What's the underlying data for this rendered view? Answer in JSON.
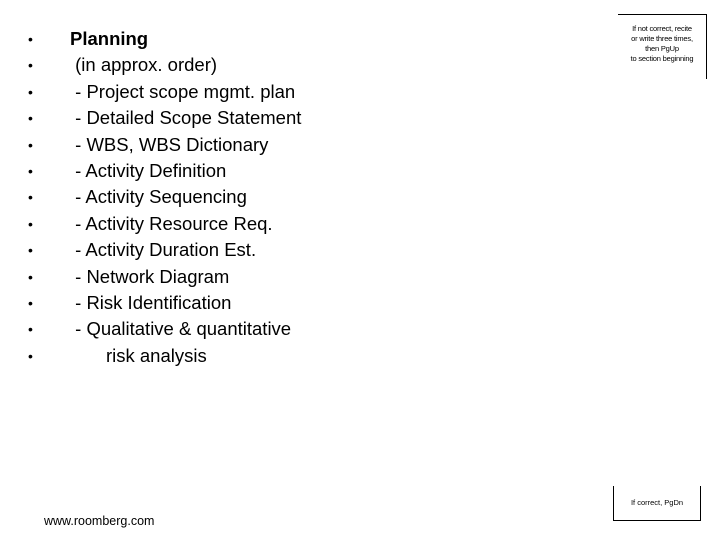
{
  "slide": {
    "items": [
      {
        "text": "Planning",
        "bold": true
      },
      {
        "text": " (in approx. order)"
      },
      {
        "text": " - Project scope mgmt. plan"
      },
      {
        "text": " - Detailed Scope Statement"
      },
      {
        "text": " - WBS, WBS Dictionary"
      },
      {
        "text": " - Activity Definition"
      },
      {
        "text": " - Activity Sequencing"
      },
      {
        "text": " - Activity Resource Req."
      },
      {
        "text": " - Activity Duration Est."
      },
      {
        "text": " - Network Diagram"
      },
      {
        "text": " - Risk Identification"
      },
      {
        "text": " - Qualitative & quantitative"
      },
      {
        "text": "       risk analysis"
      }
    ],
    "bullet_glyph": "•",
    "note_top": [
      "If not correct, recite",
      "or write three times,",
      "then PgUp",
      "to section beginning"
    ],
    "note_bottom": "If correct, PgDn",
    "footer": "www.roomberg.com"
  }
}
